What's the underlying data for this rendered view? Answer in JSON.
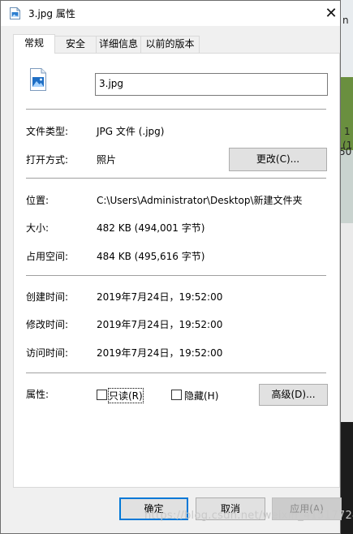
{
  "window": {
    "title": "3.jpg 属性",
    "icon": "image-file-icon",
    "close_glyph": "✕"
  },
  "tabs": [
    {
      "label": "常规",
      "active": true
    },
    {
      "label": "安全",
      "active": false
    },
    {
      "label": "详细信息",
      "active": false
    },
    {
      "label": "以前的版本",
      "active": false
    }
  ],
  "general": {
    "file_name": "3.jpg",
    "file_type": {
      "label": "文件类型:",
      "value": "JPG 文件 (.jpg)"
    },
    "opens_with": {
      "label": "打开方式:",
      "value": "照片",
      "button": "更改(C)..."
    },
    "location": {
      "label": "位置:",
      "value": "C:\\Users\\Administrator\\Desktop\\新建文件夹"
    },
    "size": {
      "label": "大小:",
      "value": "482 KB (494,001 字节)"
    },
    "size_on_disk": {
      "label": "占用空间:",
      "value": "484 KB (495,616 字节)"
    },
    "created": {
      "label": "创建时间:",
      "value": "2019年7月24日，19:52:00"
    },
    "modified": {
      "label": "修改时间:",
      "value": "2019年7月24日，19:52:00"
    },
    "accessed": {
      "label": "访问时间:",
      "value": "2019年7月24日，19:52:00"
    },
    "attributes": {
      "label": "属性:",
      "readonly": {
        "label": "只读(R)",
        "checked": false
      },
      "hidden": {
        "label": "隐藏(H)",
        "checked": false
      },
      "advanced_button": "高级(D)..."
    }
  },
  "footer": {
    "ok": "确定",
    "cancel": "取消",
    "apply": "应用(A)"
  },
  "background_glyphs": [
    "n",
    "50",
    "1",
    "(1"
  ],
  "watermark": "https://blog.csdn.net/weixin_41517724",
  "colors": {
    "accent": "#0078d7",
    "panel": "#ffffff",
    "window": "#f0f0f0"
  }
}
